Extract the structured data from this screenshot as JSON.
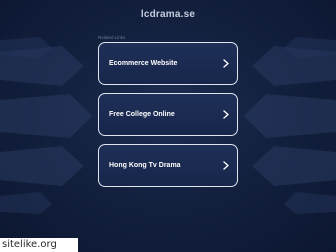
{
  "header": {
    "domain": "lcdrama.se"
  },
  "related": {
    "label": "Related Links"
  },
  "links": [
    {
      "label": "Ecommerce Website"
    },
    {
      "label": "Free College Online"
    },
    {
      "label": "Hong Kong Tv Drama"
    }
  ],
  "watermark": {
    "text": "sitelike.org"
  },
  "colors": {
    "background": "#13213f",
    "card_background": "#1e2f58",
    "card_border": "#dfe4ee",
    "text": "#ffffff"
  }
}
